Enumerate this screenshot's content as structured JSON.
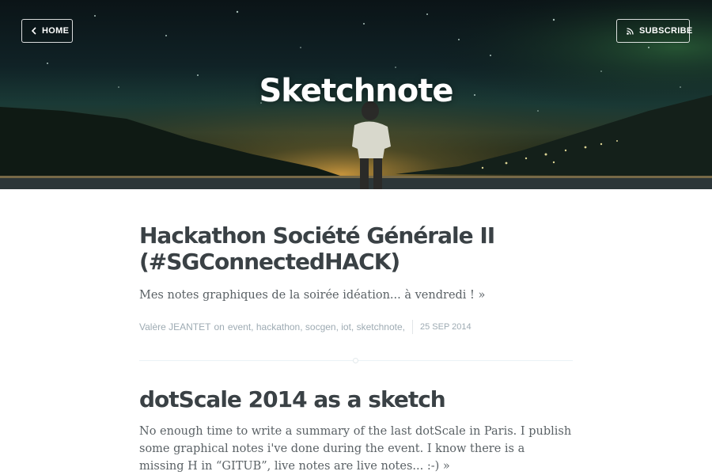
{
  "header": {
    "home_label": "HOME",
    "subscribe_label": "SUBSCRIBE",
    "blog_title": "Sketchnote"
  },
  "posts": [
    {
      "title": "Hackathon Société Générale II (#SGConnectedHACK)",
      "excerpt": "Mes notes graphiques de la soirée idéation... à vendredi !",
      "more": "»",
      "author": "Valère JEANTET",
      "on_text": "on",
      "tags": "event, hackathon, socgen, iot, sketchnote,",
      "date": "25 SEP 2014"
    },
    {
      "title": "dotScale 2014 as a sketch",
      "excerpt": "No enough time to write a summary of the last dotScale in Paris. I publish some graphical notes i've done during the event. I know there is a missing H in “GITUB”, live notes are live notes... :-)",
      "more": "»"
    }
  ],
  "icons": {
    "home_back": "chevron-left-icon",
    "subscribe": "rss-icon"
  },
  "colors": {
    "title": "#3a4145",
    "meta": "#9eabb3",
    "divider": "#ebf2f6"
  }
}
